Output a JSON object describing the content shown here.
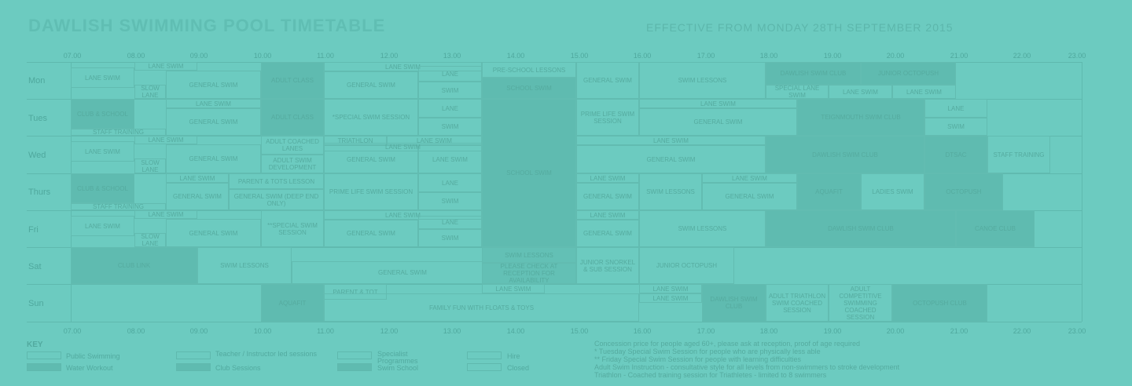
{
  "header": {
    "title": "DAWLISH SWIMMING POOL TIMETABLE",
    "effective": "EFFECTIVE FROM MONDAY 28TH SEPTEMBER 2015"
  },
  "hours": [
    "07.00",
    "08.00",
    "09.00",
    "10.00",
    "11.00",
    "12.00",
    "13.00",
    "14.00",
    "15.00",
    "16.00",
    "17.00",
    "18.00",
    "19.00",
    "20.00",
    "21.00",
    "22.00",
    "23.00"
  ],
  "days": [
    "Mon",
    "Tues",
    "Wed",
    "Thurs",
    "Fri",
    "Sat",
    "Sun"
  ],
  "sessions": {
    "mon": [
      "LANE SWIM",
      "LANE SWIM",
      "SLOW LANE",
      "GENERAL SWIM",
      "ADULT CLASS",
      "LANE SWIM",
      "GENERAL SWIM",
      "LANE",
      "SWIM",
      "PRE-SCHOOL LESSONS",
      "SCHOOL SWIM",
      "GENERAL SWIM",
      "SWIM LESSONS",
      "DAWLISH SWIM CLUB",
      "JUNIOR OCTOPUSH",
      "SPECIAL LANE SWIM",
      "LANE SWIM",
      "LANE SWIM"
    ],
    "tues": [
      "CLUB & SCHOOL",
      "STAFF TRAINING",
      "LANE SWIM",
      "GENERAL SWIM",
      "ADULT CLASS",
      "*SPECIAL SWIM SESSION",
      "LANE",
      "SWIM",
      "PRIME LIFE SWIM SESSION",
      "LANE SWIM",
      "GENERAL SWIM",
      "TEIGNMOUTH SWIM CLUB",
      "LANE",
      "SWIM"
    ],
    "wed": [
      "LANE SWIM",
      "LANE SWIM",
      "SLOW LANE",
      "GENERAL SWIM",
      "ADULT COACHED LANES",
      "ADULT SWIM DEVELOPMENT",
      "TRIATHLON",
      "LANE SWIM",
      "LANE SWIM",
      "GENERAL SWIM",
      "LANE SWIM",
      "SCHOOL SWIM",
      "LANE SWIM",
      "GENERAL SWIM",
      "DAWLISH SWIM CLUB",
      "DTSAC",
      "STAFF TRAINING"
    ],
    "thurs": [
      "CLUB & SCHOOL",
      "STAFF TRAINING",
      "LANE SWIM",
      "GENERAL SWIM",
      "PARENT & TOTS LESSON",
      "GENERAL SWIM (DEEP END ONLY)",
      "PRIME LIFE SWIM SESSION",
      "LANE",
      "SWIM",
      "LANE SWIM",
      "GENERAL SWIM",
      "SWIM LESSONS",
      "LANE SWIM",
      "GENERAL SWIM",
      "AQUAFIT",
      "LADIES SWIM",
      "OCTOPUSH"
    ],
    "fri": [
      "LANE SWIM",
      "LANE SWIM",
      "SLOW LANE",
      "GENERAL SWIM",
      "**SPECIAL SWIM SESSION",
      "LANE SWIM",
      "GENERAL SWIM",
      "LANE",
      "SWIM",
      "LANE SWIM",
      "GENERAL SWIM",
      "SWIM LESSONS",
      "DAWLISH SWIM CLUB",
      "CANOE CLUB"
    ],
    "sat": [
      "CLUB LINK",
      "SWIM LESSONS",
      "GENERAL SWIM",
      "SWIM LESSONS",
      "PLEASE CHECK AT RECEPTION FOR AVAILABILITY",
      "JUNIOR SNORKEL & SUB SESSION",
      "JUNIOR OCTOPUSH"
    ],
    "sun": [
      "AQUAFIT",
      "PARENT & TOT",
      "LANE SWIM",
      "FAMILY FUN WITH FLOATS & TOYS",
      "LANE SWIM",
      "LANE SWIM",
      "DAWLISH SWIM CLUB",
      "ADULT TRIATHLON SWIM COACHED SESSION",
      "ADULT COMPETITIVE SWIMMING COACHED SESSION",
      "OCTOPUSH CLUB"
    ]
  },
  "key": {
    "title": "KEY",
    "items": [
      "Public Swimming",
      "Water Workout",
      "Teacher / Instructor led sessions",
      "Club Sessions",
      "Specialist Programmes",
      "Swim School",
      "Hire",
      "Closed"
    ]
  },
  "notes": [
    "Concession price for people aged 60+, please ask at reception, proof of age required",
    "* Tuesday Special Swim Session for people who are physically less able",
    "** Friday Special Swim Session for people with learning difficulties",
    "Adult Swim Instruction - consultative style for all levels from non-swimmers to stroke development",
    "Triathlon - Coached training session for Triathletes - limited to 8 swimmers"
  ],
  "colors": {
    "background": "#6ccbc0",
    "block": "#5fbbb0",
    "line": "#5fb9ae"
  }
}
